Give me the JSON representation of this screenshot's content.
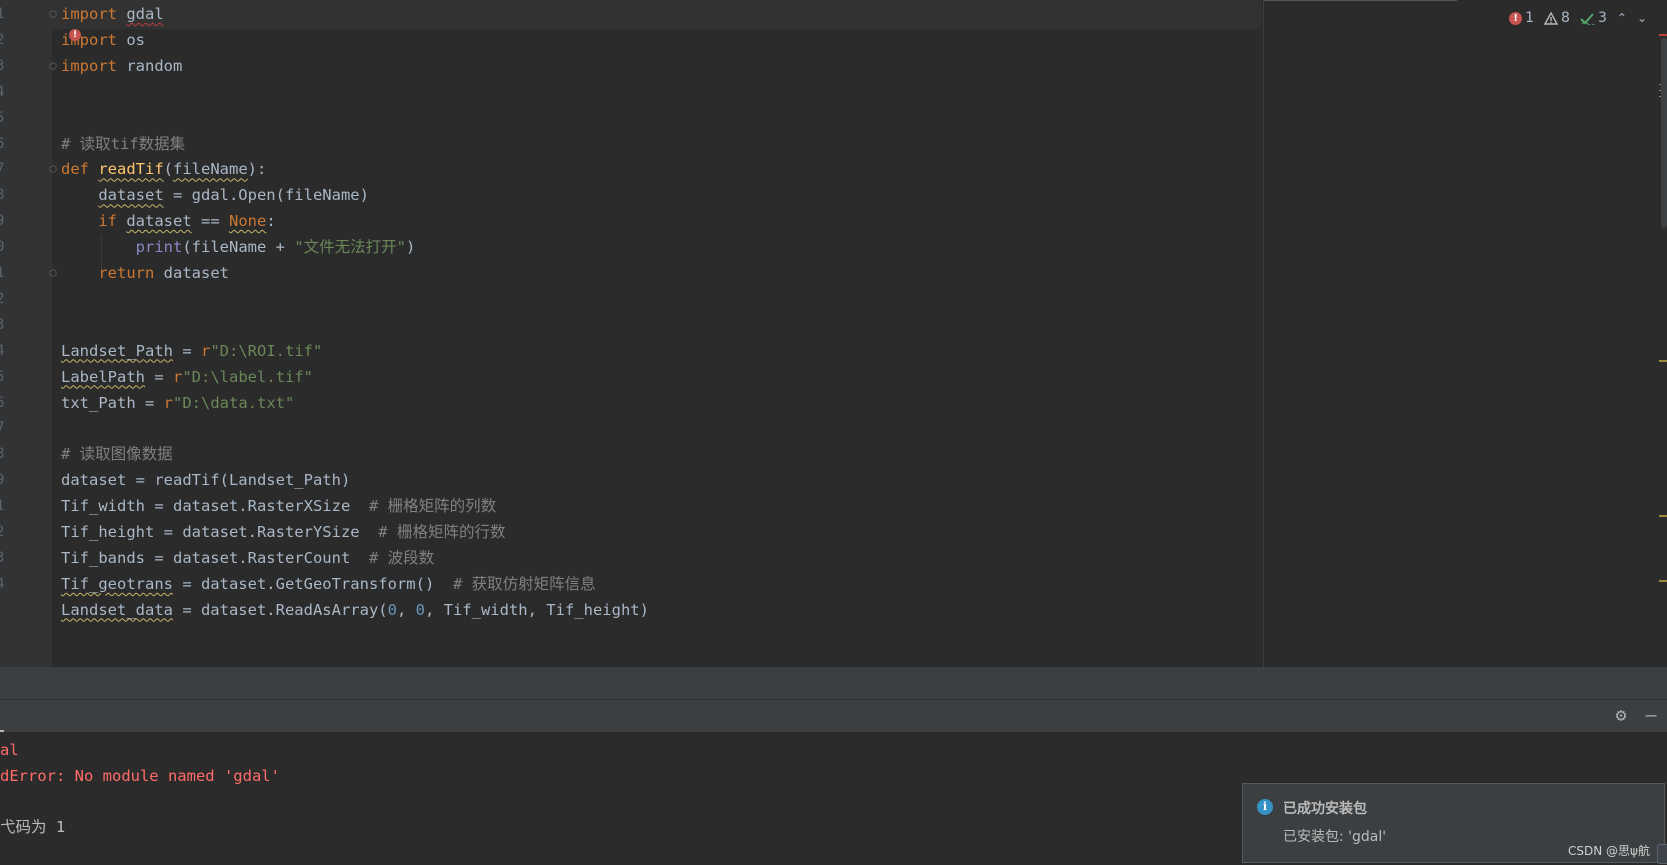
{
  "editor": {
    "line_numbers": [
      "1",
      "2",
      "3",
      "4",
      "5",
      "6",
      "7",
      "8",
      "9",
      "0",
      "1",
      "2",
      "3",
      "4",
      "5",
      "6",
      "7",
      "8",
      "9",
      "1",
      "2",
      "3",
      "4"
    ],
    "inspection": {
      "errors": "1",
      "warnings": "8",
      "weak_warnings": "3"
    },
    "code": [
      "import gdal",
      "import os",
      "import random",
      "",
      "",
      "# 读取tif数据集",
      "def readTif(fileName):",
      "    dataset = gdal.Open(fileName)",
      "    if dataset == None:",
      "        print(fileName + \"文件无法打开\")",
      "    return dataset",
      "",
      "",
      "Landset_Path = r\"D:\\ROI.tif\"",
      "LabelPath = r\"D:\\label.tif\"",
      "txt_Path = r\"D:\\data.txt\"",
      "",
      "# 读取图像数据",
      "dataset = readTif(Landset_Path)",
      "Tif_width = dataset.RasterXSize  # 栅格矩阵的列数",
      "Tif_height = dataset.RasterYSize  # 栅格矩阵的行数",
      "Tif_bands = dataset.RasterCount  # 波段数",
      "Tif_geotrans = dataset.GetGeoTransform()  # 获取仿射矩阵信息",
      "Landset_data = dataset.ReadAsArray(0, 0, Tif_width, Tif_height)"
    ]
  },
  "console": {
    "lines": [
      {
        "text": "al",
        "kind": "error"
      },
      {
        "text": "dError: No module named 'gdal'",
        "kind": "error"
      },
      {
        "text": "",
        "kind": "normal"
      },
      {
        "text": "弋码为 1",
        "kind": "normal"
      }
    ]
  },
  "notification": {
    "title": "已成功安装包",
    "body": "已安装包: 'gdal'"
  },
  "watermark": "CSDN @思ψ航",
  "colors": {
    "keyword": "#cc7832",
    "function": "#ffc66d",
    "string": "#6a8759",
    "number": "#6897bb",
    "comment": "#808080",
    "error": "#ff6b68"
  }
}
